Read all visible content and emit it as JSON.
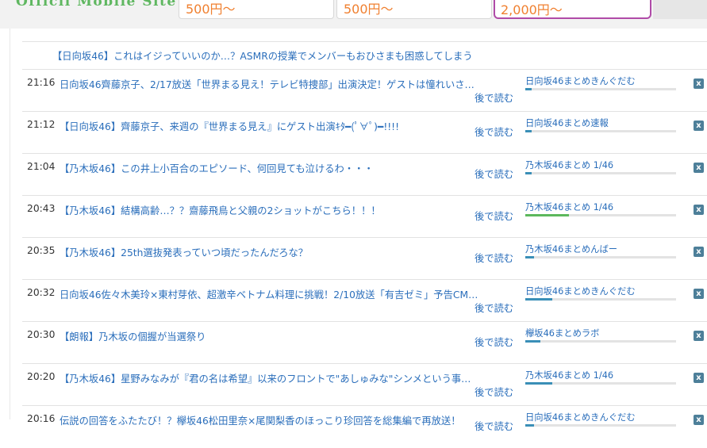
{
  "header": {
    "site_title": "Officil Mobile Site",
    "prices": [
      "500円〜",
      "500円〜",
      "2,000円〜"
    ]
  },
  "headline": "【日向坂46】これはイジっていいのか…？ASMRの授業でメンバーもおひさまも困惑してしまう",
  "read_later_label": "後で読む",
  "close_label": "x",
  "articles": [
    {
      "time": "21:16",
      "title": "日向坂46齊藤京子、2/17放送「世界まる見え！テレビ特捜部」出演決定！ゲストは憧れいさ…",
      "source": "日向坂46まとめきんぐだむ",
      "progress": 0.04,
      "bar_color": "#3a8fb7"
    },
    {
      "time": "21:12",
      "title": "【日向坂46】齊藤京子、来週の『世界まる見え』にゲスト出演ｷﾀ━(ﾟ∀ﾟ)━!!!!",
      "source": "日向坂46まとめ速報",
      "progress": 0.04,
      "bar_color": "#3a8fb7"
    },
    {
      "time": "21:04",
      "title": "【乃木坂46】この井上小百合のエピソード、何回見ても泣けるわ・・・",
      "source": "乃木坂46まとめ 1/46",
      "progress": 0.04,
      "bar_color": "#3a8fb7"
    },
    {
      "time": "20:43",
      "title": "【乃木坂46】結構高齢…？？齋藤飛鳥と父親の2ショットがこちら！！！",
      "source": "乃木坂46まとめ 1/46",
      "progress": 0.29,
      "bar_color": "#5cb85c"
    },
    {
      "time": "20:35",
      "title": "【乃木坂46】25th選抜発表っていつ頃だったんだろな？",
      "source": "乃木坂46まとめんばー",
      "progress": 0.06,
      "bar_color": "#3a8fb7"
    },
    {
      "time": "20:32",
      "title": "日向坂46佐々木美玲×東村芽依、超激辛ベトナム料理に挑戦！2/10放送「有吉ゼミ」予告CM…",
      "source": "日向坂46まとめきんぐだむ",
      "progress": 0.18,
      "bar_color": "#3a8fb7"
    },
    {
      "time": "20:30",
      "title": "【朗報】乃木坂の個握が当選祭り",
      "source": "欅坂46まとめラボ",
      "progress": 0.1,
      "bar_color": "#3a8fb7"
    },
    {
      "time": "20:20",
      "title": "【乃木坂46】星野みなみが『君の名は希望』以来のフロントで\"あしゅみな\"シンメという事…",
      "source": "乃木坂46まとめ 1/46",
      "progress": 0.18,
      "bar_color": "#3a8fb7"
    },
    {
      "time": "20:16",
      "title": "伝説の回答をふたたび！？欅坂46松田里奈×尾関梨香のほっこり珍回答を総集編で再放送！",
      "source": "日向坂46まとめきんぐだむ",
      "progress": 0.06,
      "bar_color": "#3a8fb7"
    }
  ]
}
